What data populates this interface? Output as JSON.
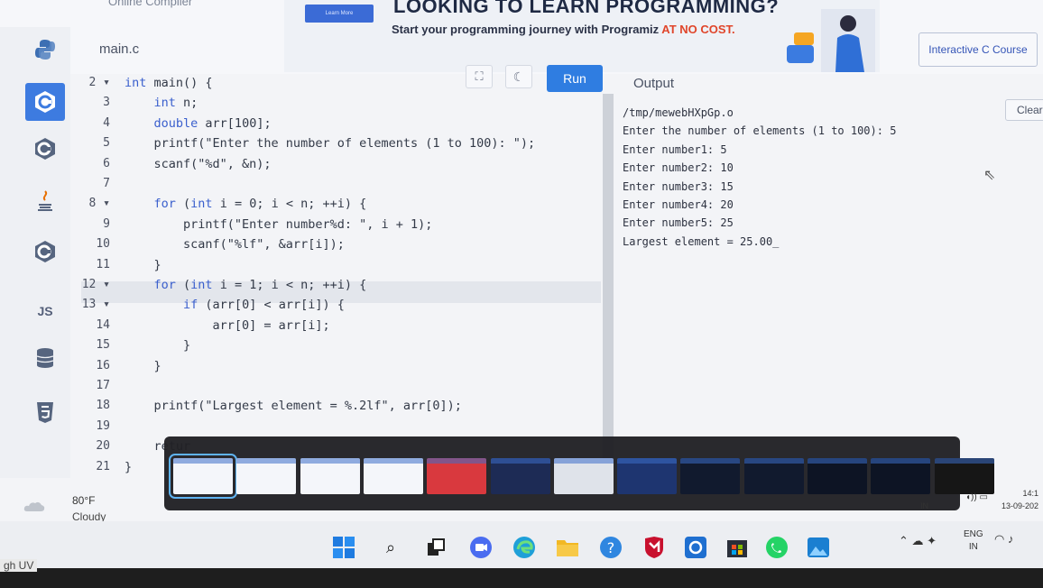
{
  "banner": {
    "site_brand": "Online Compiler",
    "learn_more": "Learn More",
    "headline": "LOOKING TO LEARN PROGRAMMING?",
    "subtitle_main": "Start your programming journey with Programiz ",
    "subtitle_highlight": "AT NO COST.",
    "course_button": "Interactive C Course"
  },
  "sidebar": {
    "items": [
      {
        "name": "python",
        "icon": "python-icon"
      },
      {
        "name": "c",
        "icon": "c-logo-icon",
        "active": true
      },
      {
        "name": "cpp",
        "icon": "cpp-logo-icon"
      },
      {
        "name": "java",
        "icon": "java-icon"
      },
      {
        "name": "csharp",
        "icon": "csharp-logo-icon"
      },
      {
        "name": "js",
        "label": "JS"
      },
      {
        "name": "sql",
        "icon": "database-icon"
      },
      {
        "name": "html",
        "icon": "html5-icon"
      }
    ]
  },
  "editor": {
    "file_name": "main.c",
    "run_label": "Run",
    "fullscreen_icon": "fullscreen-icon",
    "theme_icon": "moon-icon",
    "lines": [
      {
        "n": "2",
        "fold": true,
        "code": "int main() {"
      },
      {
        "n": "3",
        "fold": false,
        "code": "    int n;"
      },
      {
        "n": "4",
        "fold": false,
        "code": "    double arr[100];"
      },
      {
        "n": "5",
        "fold": false,
        "code": "    printf(\"Enter the number of elements (1 to 100): \");"
      },
      {
        "n": "6",
        "fold": false,
        "code": "    scanf(\"%d\", &n);"
      },
      {
        "n": "7",
        "fold": false,
        "code": ""
      },
      {
        "n": "8",
        "fold": true,
        "code": "    for (int i = 0; i < n; ++i) {"
      },
      {
        "n": "9",
        "fold": false,
        "code": "        printf(\"Enter number%d: \", i + 1);"
      },
      {
        "n": "10",
        "fold": false,
        "code": "        scanf(\"%lf\", &arr[i]);"
      },
      {
        "n": "11",
        "fold": false,
        "code": "    }"
      },
      {
        "n": "12",
        "fold": true,
        "code": "    for (int i = 1; i < n; ++i) {"
      },
      {
        "n": "13",
        "fold": true,
        "code": "        if (arr[0] < arr[i]) {"
      },
      {
        "n": "14",
        "fold": false,
        "code": "            arr[0] = arr[i];"
      },
      {
        "n": "15",
        "fold": false,
        "code": "        }"
      },
      {
        "n": "16",
        "fold": false,
        "code": "    }"
      },
      {
        "n": "17",
        "fold": false,
        "code": ""
      },
      {
        "n": "18",
        "fold": false,
        "code": "    printf(\"Largest element = %.2lf\", arr[0]);"
      },
      {
        "n": "19",
        "fold": false,
        "code": ""
      },
      {
        "n": "20",
        "fold": false,
        "code": "    retur"
      },
      {
        "n": "21",
        "fold": false,
        "code": "}"
      }
    ]
  },
  "output": {
    "title": "Output",
    "clear_label": "Clear",
    "lines": [
      "/tmp/mewebHXpGp.o",
      "Enter the number of elements (1 to 100): 5",
      "Enter number1: 5",
      "Enter number2: 10",
      "Enter number3: 15",
      "Enter number4: 20",
      "Enter number5: 25",
      "Largest element = 25.00_"
    ]
  },
  "weather": {
    "temp": "80°F",
    "condition": "Cloudy"
  },
  "tray": {
    "lang_top": "ENG",
    "lang_bottom": "IN",
    "time": "14:1",
    "date": "13-09-202",
    "small_in": "IN"
  },
  "taskbar": {
    "icons": [
      "windows-start-icon",
      "search-icon",
      "task-view-icon",
      "meet-icon",
      "edge-icon",
      "file-explorer-icon",
      "help-icon",
      "mcafee-icon",
      "app-icon",
      "store-icon",
      "whatsapp-icon",
      "photos-icon"
    ]
  },
  "laptop": {
    "brand": "gh UV"
  },
  "colors": {
    "accent": "#2f7de1",
    "active_sidebar": "#3d7be0",
    "keyword": "#3a5fcd",
    "highlight": "#e0452a",
    "switcher_selected": "#5fb3f1"
  }
}
